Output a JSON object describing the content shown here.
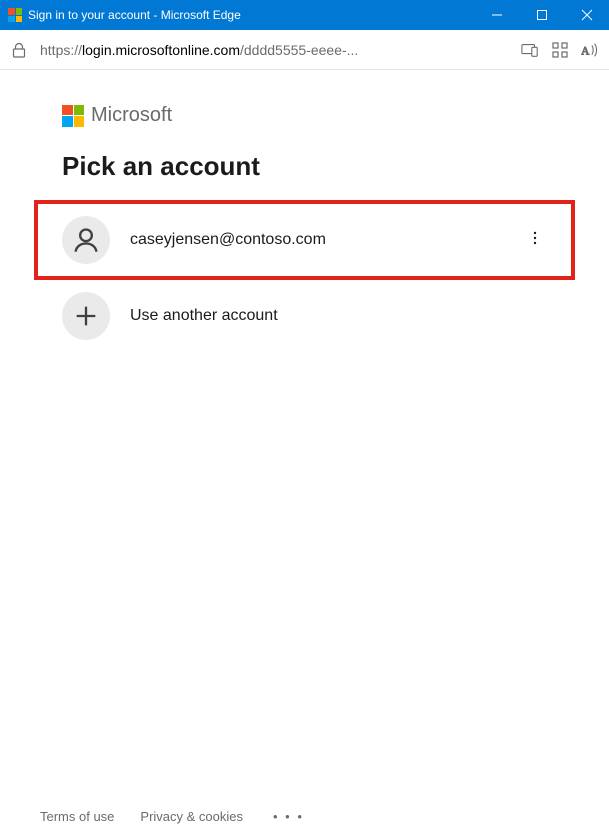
{
  "window": {
    "title": "Sign in to your account - Microsoft Edge"
  },
  "address": {
    "prefix": "https://",
    "host": "login.microsoftonline.com",
    "path": "/dddd5555-eeee-..."
  },
  "brand": {
    "name": "Microsoft"
  },
  "page": {
    "heading": "Pick an account"
  },
  "accounts": [
    {
      "label": "caseyjensen@contoso.com"
    }
  ],
  "use_another": {
    "label": "Use another account"
  },
  "footer": {
    "terms": "Terms of use",
    "privacy": "Privacy & cookies",
    "more": "• • •"
  }
}
